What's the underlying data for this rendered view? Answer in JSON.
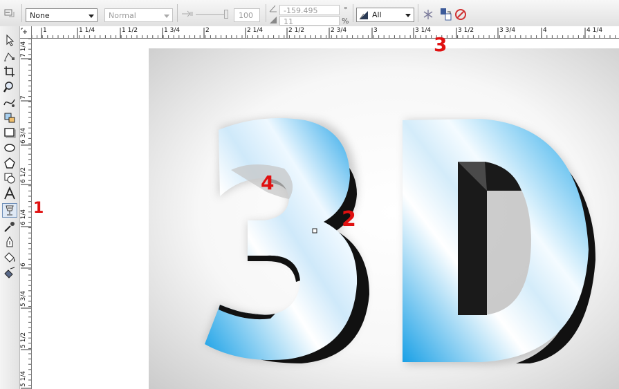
{
  "toolbar": {
    "outline_select": {
      "value": "None"
    },
    "mode_select": {
      "value": "Normal"
    },
    "opacity": {
      "value": "100"
    },
    "angle": {
      "value": "-159.495",
      "unit": "°"
    },
    "edge": {
      "value": "11",
      "unit": "%"
    },
    "target_select": {
      "value": "All"
    }
  },
  "rulers": {
    "horizontal": [
      {
        "label": "1",
        "pos": 60
      },
      {
        "label": "1 1/4",
        "pos": 112
      },
      {
        "label": "1 1/2",
        "pos": 174
      },
      {
        "label": "1 3/4",
        "pos": 235
      },
      {
        "label": "2",
        "pos": 295
      },
      {
        "label": "2 1/4",
        "pos": 355
      },
      {
        "label": "2 1/2",
        "pos": 415
      },
      {
        "label": "2 3/4",
        "pos": 476
      },
      {
        "label": "3",
        "pos": 538
      },
      {
        "label": "3 1/4",
        "pos": 598
      },
      {
        "label": "3 1/2",
        "pos": 660
      },
      {
        "label": "3 3/4",
        "pos": 720
      },
      {
        "label": "4",
        "pos": 783
      },
      {
        "label": "4 1/4",
        "pos": 846
      }
    ],
    "vertical": [
      {
        "label": "7 1/4",
        "pos": 85
      },
      {
        "label": "7",
        "pos": 146
      },
      {
        "label": "6 3/4",
        "pos": 210
      },
      {
        "label": "6 1/2",
        "pos": 267
      },
      {
        "label": "6 1/4",
        "pos": 328
      },
      {
        "label": "6",
        "pos": 388
      },
      {
        "label": "5 3/4",
        "pos": 446
      },
      {
        "label": "5 1/2",
        "pos": 506
      },
      {
        "label": "5 1/4",
        "pos": 562
      }
    ]
  },
  "annotations": {
    "m1": "1",
    "m2": "2",
    "m3": "3",
    "m4": "4"
  },
  "colors": {
    "accent_blue": "#1fa3e6",
    "annotation_red": "#e01010"
  }
}
